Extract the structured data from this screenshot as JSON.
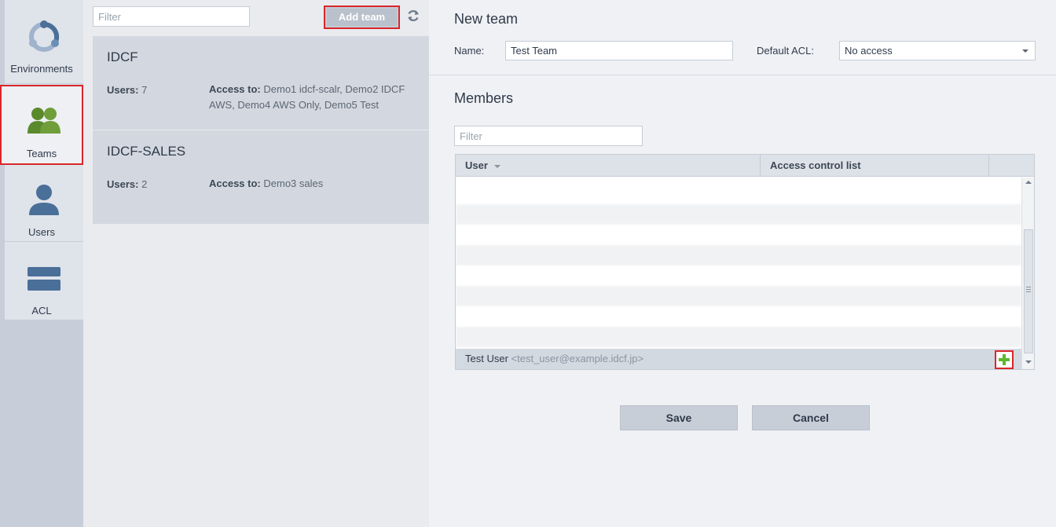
{
  "nav": {
    "items": [
      {
        "label": "Environments",
        "icon": "environments-icon"
      },
      {
        "label": "Teams",
        "icon": "teams-icon"
      },
      {
        "label": "Users",
        "icon": "user-icon"
      },
      {
        "label": "ACL",
        "icon": "acl-icon"
      }
    ]
  },
  "list": {
    "filter_placeholder": "Filter",
    "add_team_label": "Add team",
    "teams": [
      {
        "name": "IDCF",
        "users_label": "Users:",
        "users_count": "7",
        "access_label": "Access to:",
        "access_value": "Demo1 idcf-scalr, Demo2 IDCF AWS, Demo4 AWS Only, Demo5 Test"
      },
      {
        "name": "IDCF-SALES",
        "users_label": "Users:",
        "users_count": "2",
        "access_label": "Access to:",
        "access_value": "Demo3 sales"
      }
    ]
  },
  "form": {
    "title": "New team",
    "name_label": "Name:",
    "name_value": "Test Team",
    "acl_label": "Default ACL:",
    "acl_value": "No access",
    "members_title": "Members",
    "members_filter_placeholder": "Filter",
    "columns": [
      "User",
      "Access control list"
    ],
    "rows": [
      {
        "name": "",
        "email": ""
      },
      {
        "name": "",
        "email": ""
      },
      {
        "name": "",
        "email": ""
      },
      {
        "name": "",
        "email": ""
      },
      {
        "name": "",
        "email": ""
      },
      {
        "name": "",
        "email": ""
      },
      {
        "name": "",
        "email": ""
      },
      {
        "name": "",
        "email": ""
      },
      {
        "name": "",
        "email": ""
      }
    ],
    "new_row": {
      "name": "Test User",
      "email": "<test_user@example.idcf.jp>"
    },
    "save_label": "Save",
    "cancel_label": "Cancel"
  },
  "colors": {
    "accent_red": "#d9262a",
    "team_green": "#5a8a2c",
    "nav_blue": "#4a6f99",
    "add_green": "#5cb82e"
  }
}
